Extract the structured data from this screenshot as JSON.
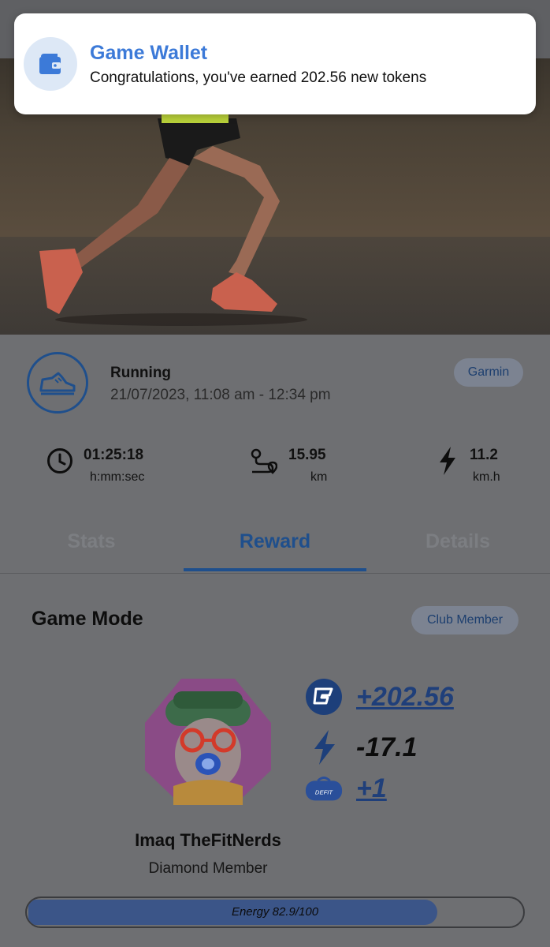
{
  "notification": {
    "title": "Game Wallet",
    "body": "Congratulations, you've earned 202.56 new tokens",
    "icon": "wallet-icon"
  },
  "activity": {
    "title": "Running",
    "time_range": "21/07/2023, 11:08 am - 12:34 pm",
    "source": "Garmin",
    "icon": "running-shoe-icon"
  },
  "metrics": [
    {
      "value": "01:25:18",
      "unit": "h:mm:sec",
      "icon": "clock-icon"
    },
    {
      "value": "15.95",
      "unit": "km",
      "icon": "route-icon"
    },
    {
      "value": "11.2",
      "unit": "km.h",
      "icon": "lightning-icon"
    }
  ],
  "tabs": [
    {
      "label": "Stats",
      "active": false
    },
    {
      "label": "Reward",
      "active": true
    },
    {
      "label": "Details",
      "active": false
    }
  ],
  "game_mode": {
    "title": "Game Mode",
    "badge": "Club Member",
    "user_name": "Imaq TheFitNerds",
    "user_tier": "Diamond Member",
    "rewards": [
      {
        "value": "+202.56",
        "icon": "token-icon"
      },
      {
        "value": "-17.1",
        "icon": "energy-icon"
      },
      {
        "value": "+1",
        "icon": "gym-bag-icon"
      }
    ],
    "energy": {
      "label": "Energy 82.9/100",
      "value": 82.9,
      "max": 100
    }
  },
  "colors": {
    "accent": "#1f4f8c",
    "notification_title": "#3c7ad8",
    "energy_fill": "#3b5588"
  }
}
